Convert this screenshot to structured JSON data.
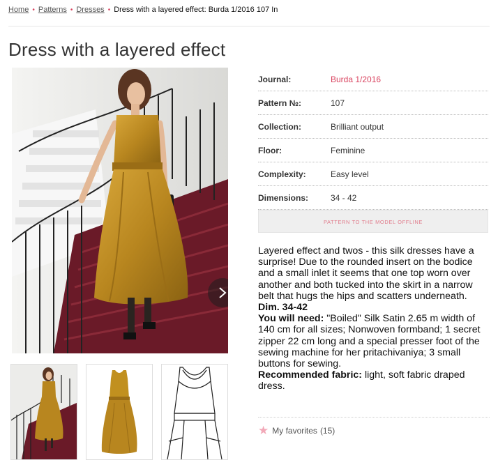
{
  "breadcrumb": {
    "home": "Home",
    "patterns": "Patterns",
    "dresses": "Dresses",
    "current": "Dress with a layered effect: Burda 1/2016 107 In",
    "separator": "•"
  },
  "page": {
    "title": "Dress with a layered effect"
  },
  "gallery": {
    "next_icon": "chevron-right-icon",
    "thumbnails": [
      "photo-staircase",
      "photo-dress-front",
      "technical-drawing"
    ]
  },
  "info": {
    "journal_label": "Journal:",
    "journal_value": "Burda 1/2016",
    "pattern_label": "Pattern №:",
    "pattern_value": "107",
    "collection_label": "Collection:",
    "collection_value": "Brilliant output",
    "floor_label": "Floor:",
    "floor_value": "Feminine",
    "complexity_label": "Complexity:",
    "complexity_value": "Easy level",
    "dimensions_label": "Dimensions:",
    "dimensions_value": "34 - 42"
  },
  "offline_button": "PATTERN TO THE MODEL OFFLINE",
  "description": {
    "intro": "Layered effect and twos - this silk dresses have a surprise! Due to the rounded insert on the bodice and a small inlet it seems that one top worn over another and both tucked into the skirt in a narrow belt that hugs the hips and scatters underneath.",
    "dim": "Dim. 34-42",
    "need_label": "You will need:",
    "need_text": " \"Boiled\" Silk Satin 2.65 m width of 140 cm for all sizes; Nonwoven formband; 1 secret zipper 22 cm long and a special presser foot of the sewing machine for her pritachivaniya; 3 small buttons for sewing.",
    "fabric_label": "Recommended fabric:",
    "fabric_text": " light, soft fabric draped dress."
  },
  "favorites": {
    "label": "My favorites",
    "count": "(15)",
    "icon": "star-icon"
  },
  "colors": {
    "accent": "#d9435f",
    "dress": "#b8861f",
    "carpet": "#6a1a28"
  }
}
